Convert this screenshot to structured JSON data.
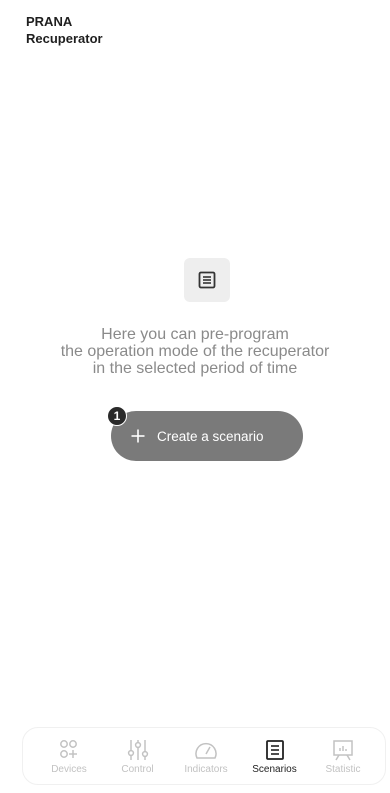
{
  "header": {
    "brand": "PRANA",
    "device": "Recuperator"
  },
  "empty_state": {
    "icon": "list-icon",
    "lines": [
      "Here you can pre-program",
      "the operation mode of the recuperator",
      "in the selected period of time"
    ]
  },
  "create": {
    "label": "Create a scenario",
    "badge": "1"
  },
  "tabs": [
    {
      "label": "Devices",
      "icon": "devices-icon",
      "active": false
    },
    {
      "label": "Control",
      "icon": "sliders-icon",
      "active": false
    },
    {
      "label": "Indicators",
      "icon": "gauge-icon",
      "active": false
    },
    {
      "label": "Scenarios",
      "icon": "list-icon",
      "active": true
    },
    {
      "label": "Statistic",
      "icon": "chart-board-icon",
      "active": false
    }
  ],
  "colors": {
    "button": "#7a7a7a",
    "badge": "#2a2a2a",
    "inactive_tab": "#c2c2c2",
    "active_tab": "#222222"
  }
}
